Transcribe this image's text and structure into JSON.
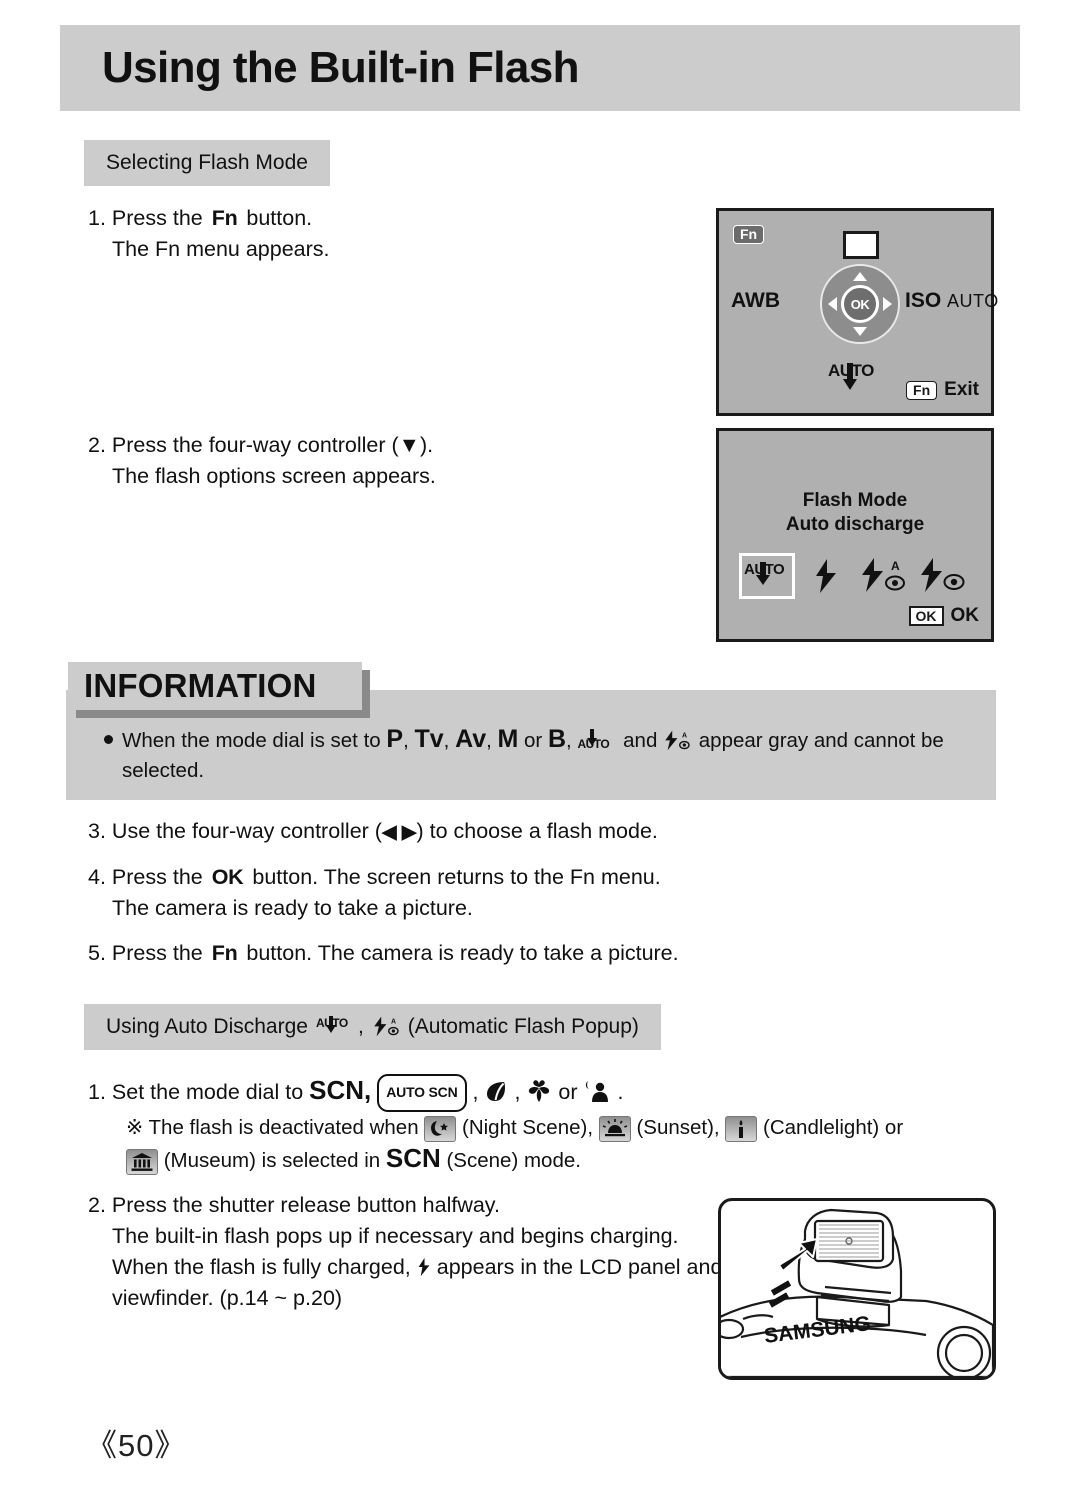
{
  "page": {
    "title": "Using the Built-in Flash",
    "number": "《50》",
    "colors": {
      "panel_gray": "#cccccc",
      "lcd_gray": "#b0b0b0",
      "shadow_gray": "#8a8a8a",
      "ink": "#111111"
    }
  },
  "sections": {
    "selecting_flash_mode": "Selecting Flash Mode",
    "using_auto_discharge_prefix": "Using Auto Discharge",
    "using_auto_discharge_suffix": "(Automatic Flash Popup)",
    "comma": ","
  },
  "steps": {
    "step1": {
      "num": "1.",
      "line1_a": "Press the",
      "line1_key": "Fn",
      "line1_b": "button.",
      "line2": "The Fn menu appears."
    },
    "step2": {
      "num": "2.",
      "line1": "Press the four-way controller (▼).",
      "line2": "The flash options screen appears."
    },
    "step3": {
      "num": "3.",
      "line1_a": "Use the four-way controller (",
      "line1_arrows": "◀ ▶",
      "line1_b": ") to choose a flash mode."
    },
    "step4": {
      "num": "4.",
      "line1_a": "Press the",
      "line1_key": "OK",
      "line1_b": "button. The screen returns to the Fn menu.",
      "line2": "The camera is ready to take a picture."
    },
    "step5": {
      "num": "5.",
      "line1_a": "Press the",
      "line1_key": "Fn",
      "line1_b": "button. The camera is ready to take a picture."
    }
  },
  "auto_discharge_steps": {
    "step1": {
      "num": "1.",
      "line1_a": "Set the mode dial to",
      "line1_scn": "SCN,",
      "line1_autoscn": "AUTO SCN",
      "line1_comma1": ",",
      "line1_comma2": ",",
      "line1_or": "or",
      "line1_end": ".",
      "note_mark": "※",
      "note_a": "The flash is deactivated when",
      "note_night": "(Night Scene),",
      "note_sunset": "(Sunset),",
      "note_candle": "(Candlelight) or",
      "note_museum": "(Museum) is selected in",
      "note_scn": "SCN",
      "note_end": "(Scene) mode."
    },
    "step2": {
      "num": "2.",
      "line1": "Press the shutter release button halfway.",
      "line2": "The built-in flash pops up if necessary and begins charging.",
      "line3_a": "When the flash is fully charged,",
      "line3_b": "appears in the LCD panel and",
      "line4": "viewfinder. (p.14 ~ p.20)"
    }
  },
  "information": {
    "label": "INFORMATION",
    "line1_a": "When the mode dial is set to",
    "modes": [
      "P",
      "Tv",
      "Av",
      "M"
    ],
    "mode_or": "or",
    "mode_b": "B",
    "comma": ",",
    "line1_and": "and",
    "line1_b": "appear gray and cannot be",
    "line2": "selected."
  },
  "lcd_fn_menu": {
    "fn_badge": "Fn",
    "awb": "AWB",
    "iso_label": "ISO",
    "iso_value": "AUTO",
    "ok_label": "OK",
    "auto_glyph": "AUTO",
    "exit_badge": "Fn",
    "exit_label": "Exit"
  },
  "lcd_flash_options": {
    "title": "Flash Mode",
    "subtitle": "Auto discharge",
    "options": [
      {
        "name": "auto-discharge",
        "label": "AUTO",
        "selected": true
      },
      {
        "name": "fill-flash",
        "label": "",
        "selected": false
      },
      {
        "name": "auto-red-eye-reduction",
        "label": "A",
        "selected": false
      },
      {
        "name": "red-eye-reduction",
        "label": "",
        "selected": false
      }
    ],
    "ok_badge": "OK",
    "ok_label": "OK"
  },
  "camera_illustration": {
    "brand": "SAMSUNG"
  }
}
